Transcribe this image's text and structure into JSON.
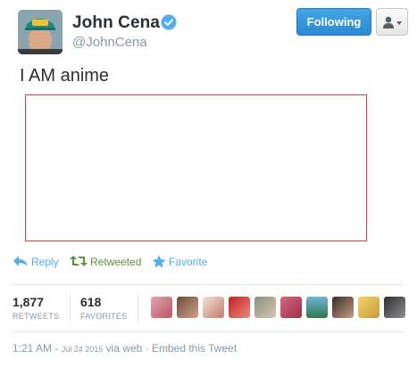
{
  "author": {
    "name": "John Cena",
    "handle": "@JohnCena"
  },
  "follow_button": {
    "label": "Following"
  },
  "tweet": {
    "text": "I AM anime"
  },
  "actions": {
    "reply": "Reply",
    "retweeted": "Retweeted",
    "favorite": "Favorite"
  },
  "stats": {
    "retweets_count": "1,877",
    "retweets_label": "RETWEETS",
    "favorites_count": "618",
    "favorites_label": "FAVORITES"
  },
  "footer": {
    "time": "1:21 AM",
    "date": "Jul 24 2015",
    "via": "via web",
    "separator": "·",
    "embed": "Embed this Tweet"
  },
  "colors": {
    "accent_blue": "#55acee",
    "retweet_green": "#5c913b",
    "follow_button": "#2c8bd3",
    "media_border": "#e23b3b",
    "muted_text": "#8899a6"
  },
  "icons": [
    "verified-icon",
    "person-icon",
    "caret-down-icon",
    "reply-icon",
    "retweet-icon",
    "star-icon"
  ]
}
